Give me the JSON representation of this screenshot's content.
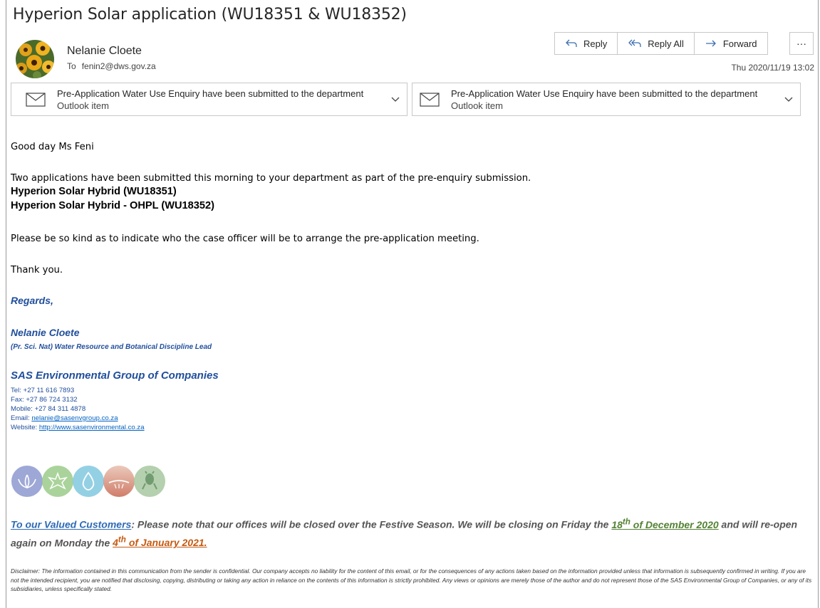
{
  "subject": "Hyperion Solar application (WU18351 & WU18352)",
  "sender": {
    "name": "Nelanie Cloete",
    "to_label": "To",
    "to_address": "fenin2@dws.gov.za",
    "date": "Thu 2020/11/19 13:02"
  },
  "actions": {
    "reply": "Reply",
    "reply_all": "Reply All",
    "forward": "Forward",
    "more": "···"
  },
  "attachments": [
    {
      "title": "Pre-Application Water Use Enquiry have been submitted to the department",
      "type": "Outlook item"
    },
    {
      "title": "Pre-Application Water Use Enquiry have been submitted to the department",
      "type": "Outlook item"
    }
  ],
  "body": {
    "greeting": "Good day Ms Feni",
    "para1": "Two applications have been submitted this morning to your department as part of the pre-enquiry submission.",
    "app1": "Hyperion Solar Hybrid (WU18351)",
    "app2": "Hyperion Solar Hybrid - OHPL (WU18352)",
    "para2": "Please be so kind as to indicate who the case officer will be to arrange the pre-application meeting.",
    "thanks": "Thank you."
  },
  "signature": {
    "regards": "Regards,",
    "name": "Nelanie Cloete",
    "role": "(Pr. Sci. Nat) Water Resource and Botanical Discipline Lead",
    "company": "SAS Environmental Group of Companies",
    "tel": "Tel: +27 11 616 7893",
    "fax": "Fax: +27 86 724 3132",
    "mobile": "Mobile: +27 84 311 4878",
    "email_label": "Email: ",
    "email": "nelanie@sasenvgroup.co.za",
    "website_label": "Website: ",
    "website": "http://www.sasenvironmental.co.za"
  },
  "notice": {
    "link": "To our Valued Customers",
    "text1": ":  Please note that our offices will be closed over the Festive Season.  We will be closing on Friday the ",
    "date1_num": "18",
    "date1_sup": "th",
    "date1_rest": " of December 2020",
    "text2": " and will re-open again on Monday the ",
    "date2_num": "4",
    "date2_sup": "th",
    "date2_rest": " of January 2021."
  },
  "disclaimer": "Disclaimer: The information contained in this communication from the sender is confidential. Our company accepts no liability for the content of this email, or for the consequences of any actions taken based on the information provided unless that information is subsequently confirmed in writing. If you are not the intended recipient, you are notified that disclosing, copying, distributing or taking any action in reliance on the contents of this information is strictly prohibited. Any views or opinions are merely those of the author and do not represent those of the SAS Environmental Group of Companies, or any of its subsidiaries, unless specifically stated.",
  "colors": {
    "signature_blue": "#1f4e9b",
    "link_green": "#548235",
    "link_orange": "#c55a11"
  }
}
